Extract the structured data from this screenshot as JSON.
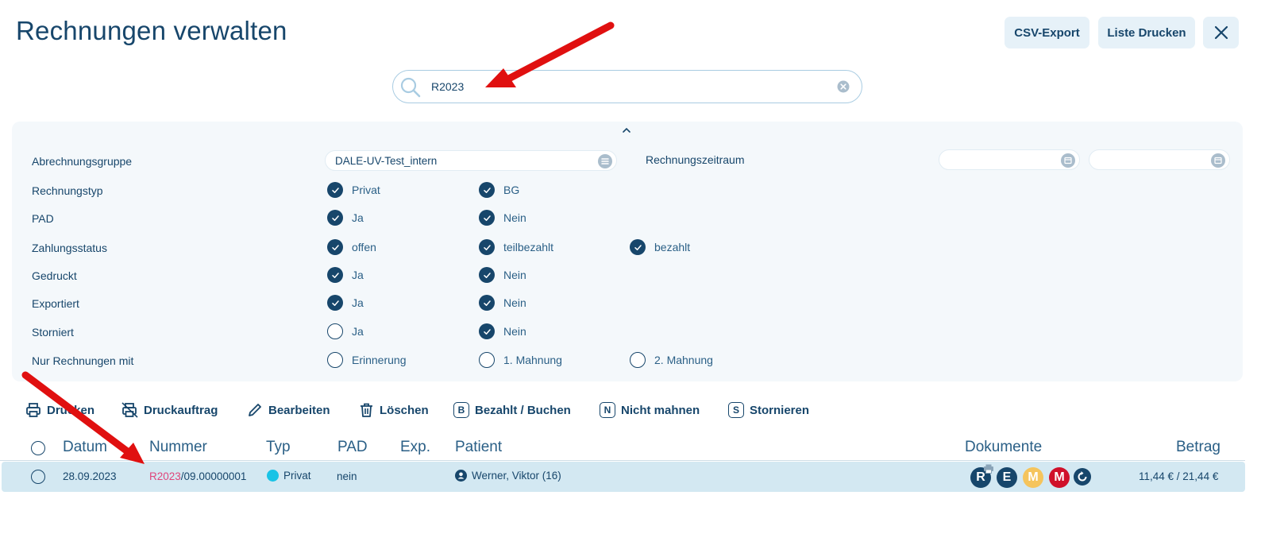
{
  "header": {
    "title": "Rechnungen verwalten",
    "csv_export": "CSV-Export",
    "print_list": "Liste Drucken"
  },
  "search": {
    "value": "R2023"
  },
  "filters": {
    "abrechnungsgruppe": {
      "label": "Abrechnungsgruppe",
      "value": "DALE-UV-Test_intern"
    },
    "rechnungszeitraum": {
      "label": "Rechnungszeitraum"
    },
    "rechnungstyp": {
      "label": "Rechnungstyp",
      "options": [
        {
          "label": "Privat",
          "checked": true
        },
        {
          "label": "BG",
          "checked": true
        }
      ]
    },
    "pad": {
      "label": "PAD",
      "options": [
        {
          "label": "Ja",
          "checked": true
        },
        {
          "label": "Nein",
          "checked": true
        }
      ]
    },
    "zahlungsstatus": {
      "label": "Zahlungsstatus",
      "options": [
        {
          "label": "offen",
          "checked": true
        },
        {
          "label": "teilbezahlt",
          "checked": true
        },
        {
          "label": "bezahlt",
          "checked": true
        }
      ]
    },
    "gedruckt": {
      "label": "Gedruckt",
      "options": [
        {
          "label": "Ja",
          "checked": true
        },
        {
          "label": "Nein",
          "checked": true
        }
      ]
    },
    "exportiert": {
      "label": "Exportiert",
      "options": [
        {
          "label": "Ja",
          "checked": true
        },
        {
          "label": "Nein",
          "checked": true
        }
      ]
    },
    "storniert": {
      "label": "Storniert",
      "options": [
        {
          "label": "Ja",
          "checked": false
        },
        {
          "label": "Nein",
          "checked": true
        }
      ]
    },
    "nur_rechnungen_mit": {
      "label": "Nur Rechnungen mit",
      "options": [
        {
          "label": "Erinnerung",
          "checked": false
        },
        {
          "label": "1. Mahnung",
          "checked": false
        },
        {
          "label": "2. Mahnung",
          "checked": false
        }
      ]
    }
  },
  "actions": {
    "drucken": "Drucken",
    "druckauftrag": "Druckauftrag",
    "bearbeiten": "Bearbeiten",
    "loeschen": "Löschen",
    "bezahlt": "Bezahlt / Buchen",
    "nicht_mahnen": "Nicht mahnen",
    "stornieren": "Stornieren",
    "bezahlt_letter": "B",
    "nicht_mahnen_letter": "N",
    "stornieren_letter": "S"
  },
  "table": {
    "columns": {
      "datum": "Datum",
      "nummer": "Nummer",
      "typ": "Typ",
      "pad": "PAD",
      "exp": "Exp.",
      "patient": "Patient",
      "dokumente": "Dokumente",
      "betrag": "Betrag"
    },
    "rows": [
      {
        "datum": "28.09.2023",
        "nummer_match": "R2023",
        "nummer_rest": "/09.00000001",
        "typ": "Privat",
        "pad": "nein",
        "patient": "Werner, Viktor (16)",
        "documents": [
          "R",
          "E",
          "M",
          "M"
        ],
        "betrag": "11,44 € / 21,44 €"
      }
    ]
  },
  "colors": {
    "primary": "#17466b",
    "highlight": "#e0457b",
    "typ_privat": "#19c3e6",
    "doc_m_yellow": "#f5c45c",
    "doc_m_red": "#d0102a",
    "annotation_arrow": "#e01010",
    "row_selected": "#d3e8f2"
  }
}
